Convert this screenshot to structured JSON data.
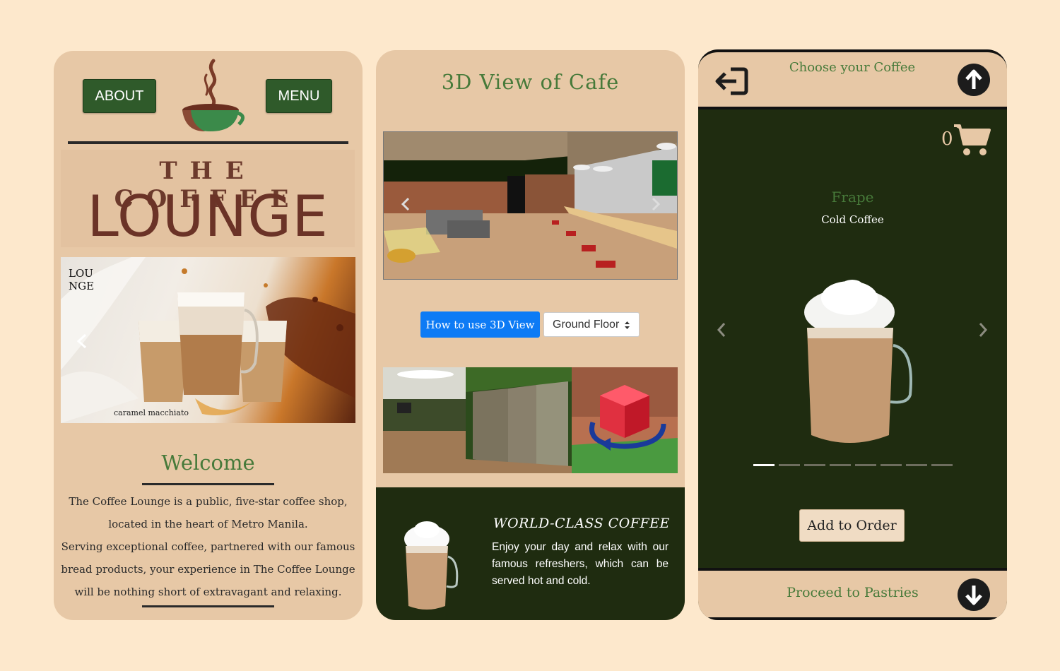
{
  "colors": {
    "page_bg": "#fde8cc",
    "panel_bg": "#e7c8a6",
    "brand_green": "#477a3a",
    "button_green": "#2f5a2a",
    "dark_green": "#1f2c10",
    "brand_brown": "#6b3327",
    "accent_blue": "#0d7bf5"
  },
  "home": {
    "about_label": "ABOUT",
    "menu_label": "MENU",
    "brand_top": "THE COFFEE",
    "brand_bottom": "LOUNGE",
    "hero_mark_line1": "LOU",
    "hero_mark_line2": "NGE",
    "hero_caption": "caramel macchiato",
    "welcome_title": "Welcome",
    "welcome_p1": "The Coffee Lounge is a public, five-star coffee shop, located in the heart of Metro Manila.",
    "welcome_p2": "Serving exceptional coffee, partnered with our famous bread products, your experience in The Coffee Lounge will be nothing short of extravagant and relaxing."
  },
  "view3d": {
    "title": "3D View of Cafe",
    "help_button": "How to use 3D View",
    "floor_select": "Ground Floor",
    "promo_title": "WORLD-CLASS COFFEE",
    "promo_text": "Enjoy your day and relax with our famous refreshers, which can be served hot and cold."
  },
  "order": {
    "header_title": "Choose your Coffee",
    "cart_count": "0",
    "item_name": "Frape",
    "item_sub": "Cold Coffee",
    "carousel_count": 8,
    "carousel_active": 1,
    "add_button": "Add to Order",
    "footer_title": "Proceed to Pastries"
  }
}
